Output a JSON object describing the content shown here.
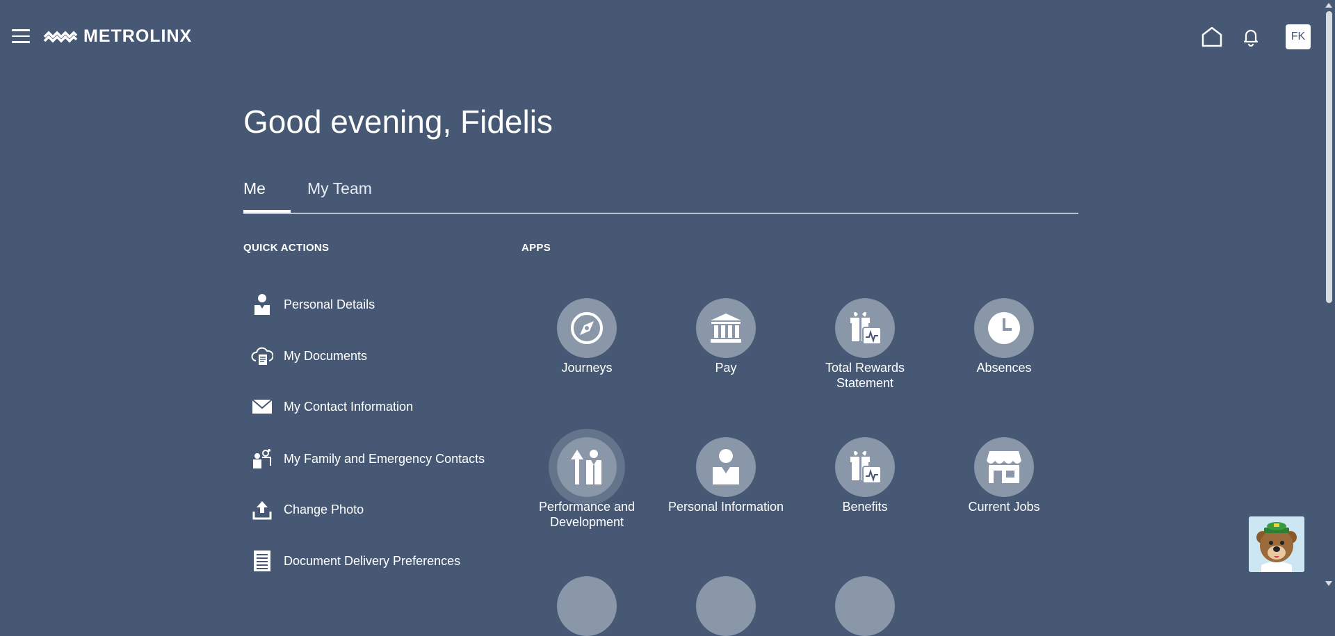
{
  "header": {
    "logo_text": "METROLINX",
    "avatar_initials": "FK",
    "icons": [
      "menu-icon",
      "home-icon",
      "bell-icon"
    ]
  },
  "greeting": "Good evening, Fidelis",
  "tabs": [
    {
      "label": "Me",
      "active": true
    },
    {
      "label": "My Team",
      "active": false
    }
  ],
  "quick_actions": {
    "heading": "QUICK ACTIONS",
    "items": [
      {
        "label": "Personal Details",
        "icon": "person-icon"
      },
      {
        "label": "My Documents",
        "icon": "cloud-document-icon"
      },
      {
        "label": "My Contact Information",
        "icon": "envelope-icon"
      },
      {
        "label": "My Family and Emergency Contacts",
        "icon": "family-icon"
      },
      {
        "label": "Change Photo",
        "icon": "upload-icon"
      },
      {
        "label": "Document Delivery Preferences",
        "icon": "document-icon"
      }
    ]
  },
  "apps": {
    "heading": "APPS",
    "items": [
      {
        "label": "Journeys",
        "icon": "compass-icon"
      },
      {
        "label": "Pay",
        "icon": "bank-icon"
      },
      {
        "label": "Total Rewards Statement",
        "icon": "gift-chart-icon"
      },
      {
        "label": "Absences",
        "icon": "clock-icon"
      },
      {
        "label": "Performance and Development",
        "icon": "growth-icon"
      },
      {
        "label": "Personal Information",
        "icon": "person-icon"
      },
      {
        "label": "Benefits",
        "icon": "gift-chart-icon"
      },
      {
        "label": "Current Jobs",
        "icon": "store-icon"
      }
    ]
  },
  "colors": {
    "background": "#465873",
    "app_circle": "#8a97a9"
  }
}
